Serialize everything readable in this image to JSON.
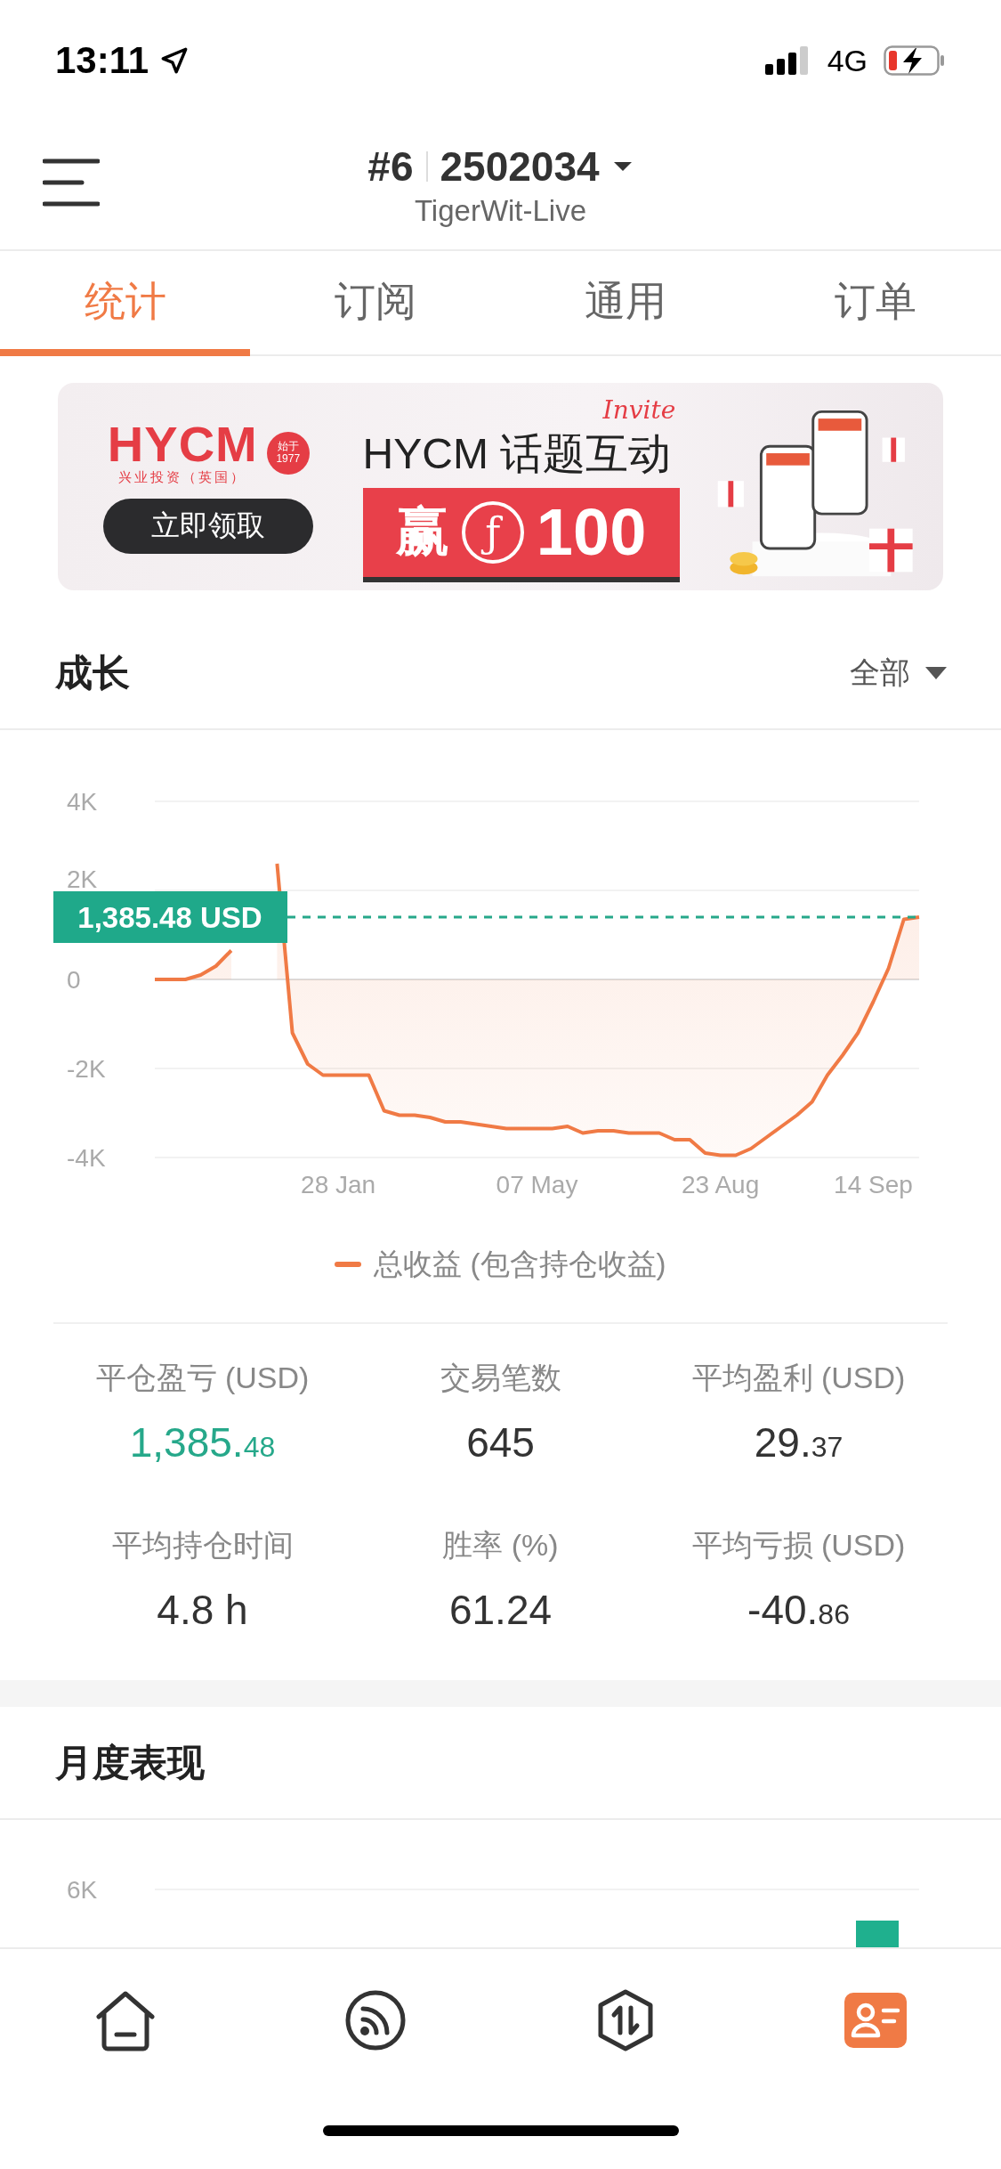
{
  "status_bar": {
    "time": "13:11",
    "network": "4G"
  },
  "header": {
    "account_index": "#6",
    "account_number": "2502034",
    "server": "TigerWit-Live"
  },
  "tabs": [
    {
      "label": "统计",
      "selected": true
    },
    {
      "label": "订阅",
      "selected": false
    },
    {
      "label": "通用",
      "selected": false
    },
    {
      "label": "订单",
      "selected": false
    }
  ],
  "banner": {
    "logo": "HYCM",
    "logo_caption": "兴业投资（英国）",
    "badge_top": "始于",
    "badge_year": "1977",
    "button": "立即领取",
    "headline": "HYCM 话题互动",
    "script_word": "Invite",
    "prize_prefix": "赢",
    "prize_symbol": "ƒ",
    "prize_amount": "100"
  },
  "growth": {
    "title": "成长",
    "range": "全部",
    "current_label": "1,385.48 USD",
    "chart_data": {
      "type": "area",
      "categories": [
        null,
        null,
        null,
        null,
        null,
        null,
        null,
        null,
        null,
        null,
        null,
        null,
        "28 Jan",
        null,
        null,
        null,
        null,
        null,
        null,
        null,
        null,
        null,
        null,
        null,
        null,
        "07 May",
        null,
        null,
        null,
        null,
        null,
        null,
        null,
        null,
        null,
        null,
        null,
        "23 Aug",
        null,
        null,
        null,
        null,
        null,
        null,
        null,
        null,
        null,
        "14 Sep",
        null,
        null,
        null
      ],
      "series": [
        {
          "name": "总收益 (包含持仓收益)",
          "color": "#f07a45",
          "values": [
            0,
            0,
            0,
            100,
            300,
            650,
            null,
            null,
            2600,
            -1200,
            -1900,
            -2150,
            -2150,
            -2150,
            -2150,
            -2950,
            -3050,
            -3050,
            -3100,
            -3200,
            -3200,
            -3250,
            -3300,
            -3350,
            -3350,
            -3350,
            -3350,
            -3300,
            -3450,
            -3400,
            -3400,
            -3450,
            -3450,
            -3450,
            -3600,
            -3600,
            -3900,
            -3950,
            -3950,
            -3800,
            -3550,
            -3300,
            -3050,
            -2750,
            -2150,
            -1700,
            -1200,
            -500,
            250,
            1350,
            1400
          ]
        }
      ],
      "ylim": [
        -4000,
        4000
      ],
      "yticks": [
        {
          "value": 4000,
          "label": "4K"
        },
        {
          "value": 2000,
          "label": "2K"
        },
        {
          "value": 0,
          "label": "0"
        },
        {
          "value": -2000,
          "label": "-2K"
        },
        {
          "value": -4000,
          "label": "-4K"
        }
      ]
    }
  },
  "stats": [
    {
      "label": "平仓盈亏 (USD)",
      "value": "1,385.",
      "decimals": "48",
      "color": "#26a88a"
    },
    {
      "label": "交易笔数",
      "value": "645",
      "color": "#333333"
    },
    {
      "label": "平均盈利 (USD)",
      "value": "29.",
      "decimals": "37",
      "color": "#333333"
    },
    {
      "label": "平均持仓时间",
      "value": "4.8 h",
      "color": "#333333"
    },
    {
      "label": "胜率 (%)",
      "value": "61.24",
      "color": "#333333"
    },
    {
      "label": "平均亏损 (USD)",
      "value": "-40.",
      "decimals": "86",
      "color": "#333333"
    }
  ],
  "monthly": {
    "title": "月度表现",
    "axis_label": "6K"
  },
  "bottom_nav": [
    {
      "kind": "home",
      "selected": false
    },
    {
      "kind": "feed",
      "selected": false
    },
    {
      "kind": "trade",
      "selected": false
    },
    {
      "kind": "account",
      "selected": true
    }
  ]
}
